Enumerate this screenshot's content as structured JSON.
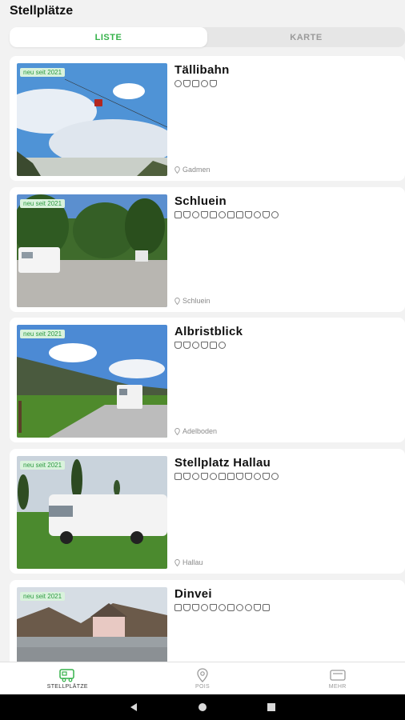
{
  "header": {
    "title": "Stellplätze"
  },
  "tabs": [
    {
      "label": "LISTE",
      "active": true
    },
    {
      "label": "KARTE",
      "active": false
    }
  ],
  "badge_text": "neu seit 2021",
  "places": [
    {
      "name": "Tällibahn",
      "location": "Gadmen",
      "amenities": [
        "no-smoking-icon",
        "campfire-icon",
        "shower-icon",
        "wifi-icon",
        "pet-icon"
      ]
    },
    {
      "name": "Schluein",
      "location": "Schluein",
      "amenities": [
        "list-icon",
        "picnic-icon",
        "pin-icon",
        "pet-icon",
        "cart-icon",
        "snow-icon",
        "camper-icon",
        "calendar-icon",
        "campfire-icon",
        "wheelchair-icon",
        "basket-icon",
        "bike-icon"
      ]
    },
    {
      "name": "Albristblick",
      "location": "Adelboden",
      "amenities": [
        "campfire-icon",
        "picnic-icon",
        "pin-icon",
        "pet-icon",
        "cart-icon",
        "bike-icon"
      ]
    },
    {
      "name": "Stellplatz Hallau",
      "location": "Hallau",
      "amenities": [
        "cart-icon",
        "picnic-icon",
        "pin-icon",
        "pet-icon",
        "snow-icon",
        "camper-icon",
        "calendar-icon",
        "campfire-icon",
        "tent-icon",
        "wheelchair-icon",
        "basket-icon",
        "bike-icon"
      ]
    },
    {
      "name": "Dinvei",
      "location": "",
      "amenities": [
        "cart-icon",
        "campfire-icon",
        "picnic-icon",
        "pin-icon",
        "pet-icon",
        "snow-icon",
        "calendar-icon",
        "wifi-icon",
        "wheelchair-icon",
        "basket-icon",
        "chat-icon"
      ]
    }
  ],
  "bottom_nav": [
    {
      "label": "STELLPLÄTZE",
      "icon": "camper-icon",
      "active": true
    },
    {
      "label": "POIS",
      "icon": "map-pin-icon",
      "active": false
    },
    {
      "label": "MEHR",
      "icon": "more-card-icon",
      "active": false
    }
  ],
  "system_nav": [
    "back-icon",
    "home-icon",
    "recents-icon"
  ],
  "colors": {
    "accent": "#35b24a",
    "badge_bg": "#d9f2dc",
    "background": "#f2f2f2"
  }
}
